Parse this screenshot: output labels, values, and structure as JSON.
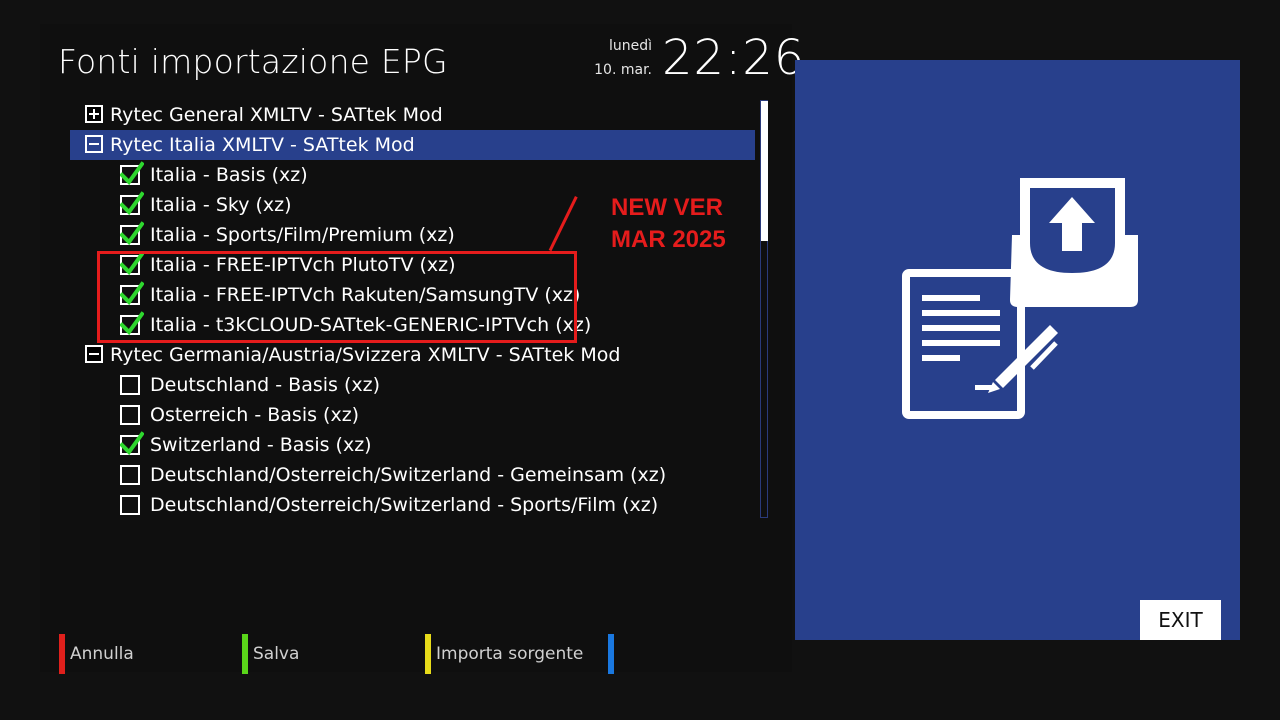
{
  "header": {
    "title": "Fonti importazione EPG",
    "day": "lunedì",
    "date": "10. mar.",
    "time": "22:26"
  },
  "list": [
    {
      "kind": "group",
      "expanded": false,
      "selected": false,
      "label": "Rytec General XMLTV - SATtek Mod"
    },
    {
      "kind": "group",
      "expanded": true,
      "selected": true,
      "label": "Rytec Italia XMLTV - SATtek Mod"
    },
    {
      "kind": "item",
      "checked": true,
      "label": "Italia - Basis (xz)"
    },
    {
      "kind": "item",
      "checked": true,
      "label": "Italia - Sky (xz)"
    },
    {
      "kind": "item",
      "checked": true,
      "label": "Italia - Sports/Film/Premium (xz)"
    },
    {
      "kind": "item",
      "checked": true,
      "label": "Italia - FREE-IPTVch PlutoTV (xz)"
    },
    {
      "kind": "item",
      "checked": true,
      "label": "Italia - FREE-IPTVch Rakuten/SamsungTV (xz)"
    },
    {
      "kind": "item",
      "checked": true,
      "label": "Italia - t3kCLOUD-SATtek-GENERIC-IPTVch (xz)"
    },
    {
      "kind": "group",
      "expanded": true,
      "selected": false,
      "label": "Rytec Germania/Austria/Svizzera XMLTV - SATtek Mod"
    },
    {
      "kind": "item",
      "checked": false,
      "label": "Deutschland - Basis  (xz)"
    },
    {
      "kind": "item",
      "checked": false,
      "label": "Osterreich - Basis  (xz)"
    },
    {
      "kind": "item",
      "checked": true,
      "label": "Switzerland - Basis  (xz)"
    },
    {
      "kind": "item",
      "checked": false,
      "label": "Deutschland/Osterreich/Switzerland - Gemeinsam  (xz)"
    },
    {
      "kind": "item",
      "checked": false,
      "label": "Deutschland/Osterreich/Switzerland - Sports/Film  (xz)"
    }
  ],
  "annotation": {
    "line1": "NEW VER",
    "line2": "MAR 2025",
    "color": "#e51c1c"
  },
  "footer": {
    "red_label": "Annulla",
    "green_label": "Salva",
    "yellow_label": "Importa sorgente",
    "blue_label": ""
  },
  "colors": {
    "red": "#e0201c",
    "green": "#5ad61a",
    "yellow": "#e8dc1a",
    "blue": "#1a78e0",
    "accent": "#28408c",
    "check": "#2ed82e"
  },
  "preview": {
    "icon": "document-upload-icon",
    "exit_label": "EXIT"
  }
}
